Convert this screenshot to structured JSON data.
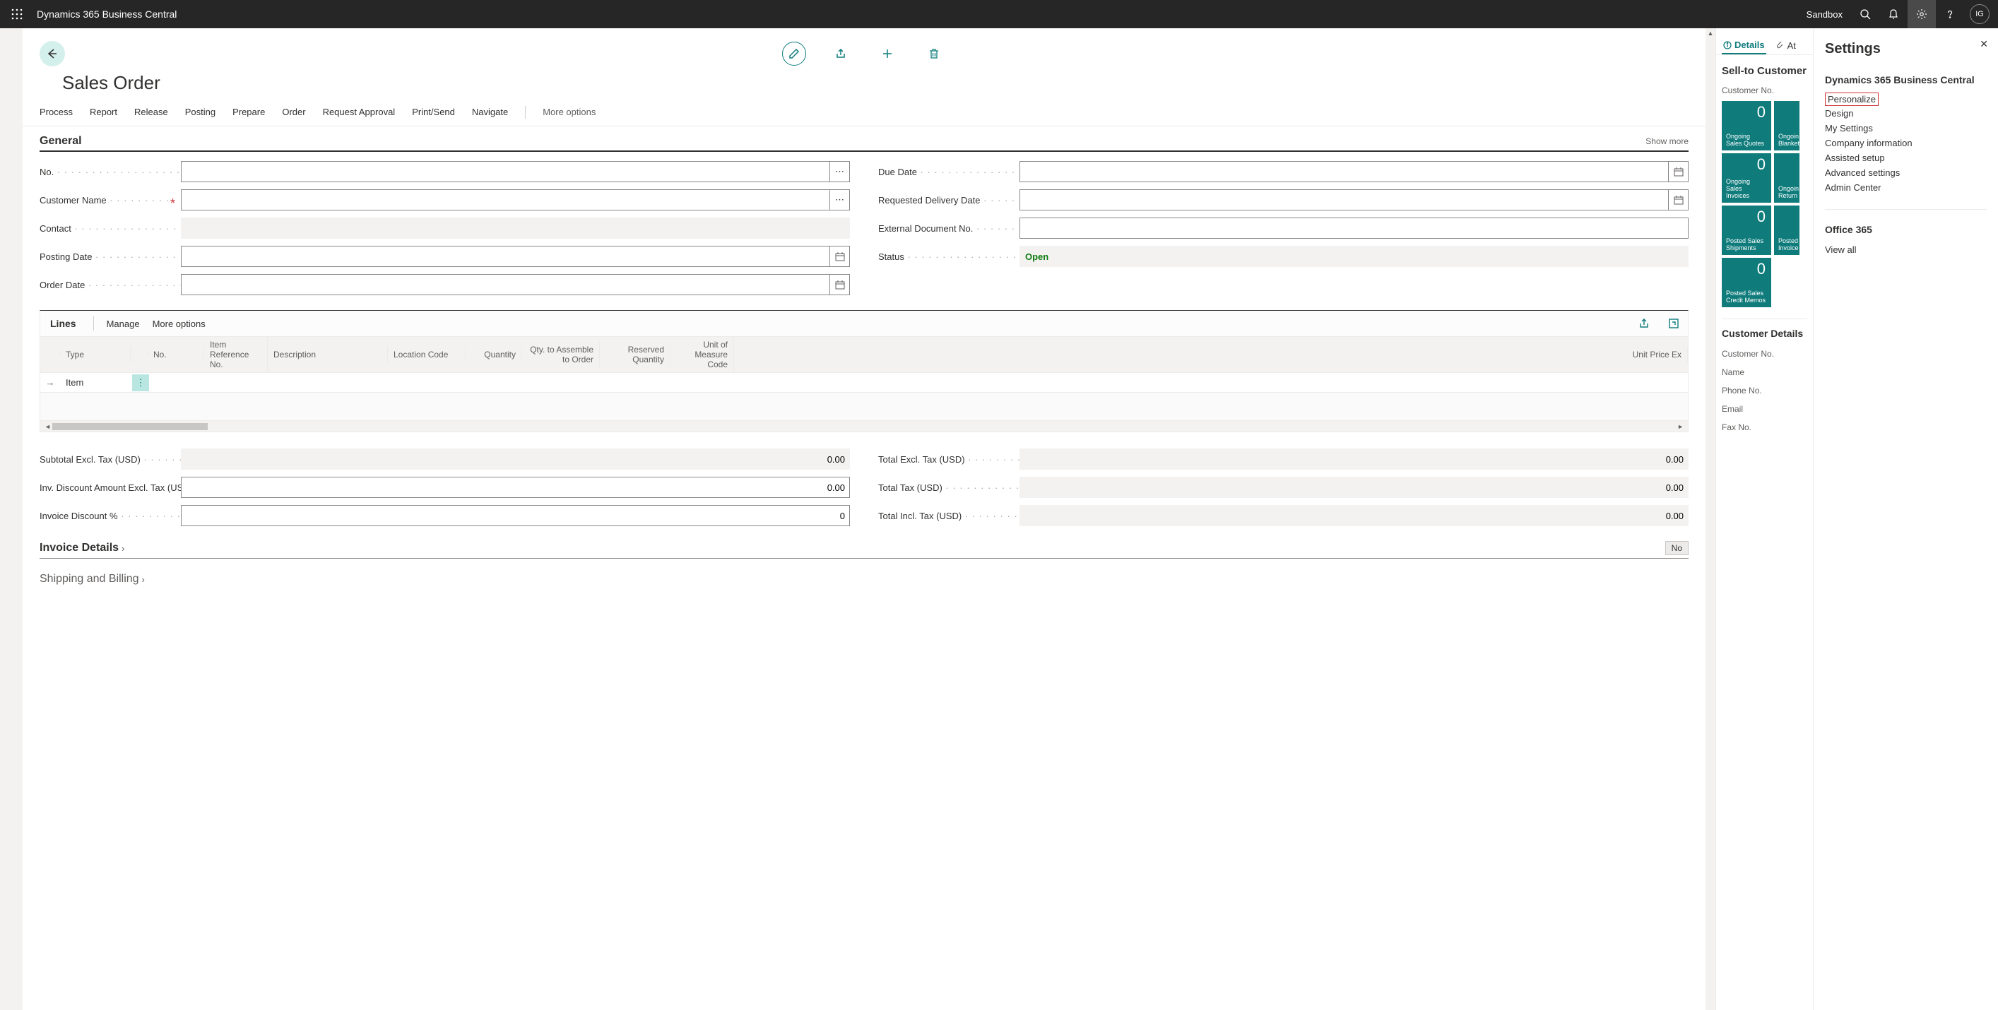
{
  "topbar": {
    "app_title": "Dynamics 365 Business Central",
    "env": "Sandbox",
    "user_initials": "IG"
  },
  "page": {
    "title": "Sales Order"
  },
  "actions": {
    "process": "Process",
    "report": "Report",
    "release": "Release",
    "posting": "Posting",
    "prepare": "Prepare",
    "order": "Order",
    "request_approval": "Request Approval",
    "print_send": "Print/Send",
    "navigate": "Navigate",
    "more": "More options"
  },
  "general": {
    "title": "General",
    "show_more": "Show more",
    "labels": {
      "no": "No.",
      "customer_name": "Customer Name",
      "contact": "Contact",
      "posting_date": "Posting Date",
      "order_date": "Order Date",
      "due_date": "Due Date",
      "requested_delivery": "Requested Delivery Date",
      "external_doc": "External Document No.",
      "status": "Status"
    },
    "values": {
      "no": "",
      "customer_name": "",
      "contact": "",
      "posting_date": "",
      "order_date": "",
      "due_date": "",
      "requested_delivery": "",
      "external_doc": "",
      "status": "Open"
    }
  },
  "lines": {
    "title": "Lines",
    "manage": "Manage",
    "more": "More options",
    "columns": {
      "type": "Type",
      "no": "No.",
      "item_ref": "Item Reference No.",
      "description": "Description",
      "location": "Location Code",
      "quantity": "Quantity",
      "qty_assemble": "Qty. to Assemble to Order",
      "reserved": "Reserved Quantity",
      "uom": "Unit of Measure Code",
      "unit_price": "Unit Price Ex"
    },
    "row0_type": "Item"
  },
  "totals": {
    "subtotal_label": "Subtotal Excl. Tax (USD)",
    "subtotal": "0.00",
    "inv_disc_amt_label": "Inv. Discount Amount Excl. Tax (USD)",
    "inv_disc_amt": "0.00",
    "inv_disc_pct_label": "Invoice Discount %",
    "inv_disc_pct": "0",
    "total_excl_label": "Total Excl. Tax (USD)",
    "total_excl": "0.00",
    "total_tax_label": "Total Tax (USD)",
    "total_tax": "0.00",
    "total_incl_label": "Total Incl. Tax (USD)",
    "total_incl": "0.00"
  },
  "invoice_details": {
    "title": "Invoice Details",
    "badge": "No"
  },
  "shipping": {
    "title": "Shipping and Billing"
  },
  "factbox": {
    "tabs": {
      "details": "Details",
      "attachments": "At"
    },
    "sell_to": "Sell-to Customer",
    "customer_no_label": "Customer No.",
    "tiles": [
      {
        "count": "0",
        "label": "Ongoing Sales Quotes"
      },
      {
        "count": "",
        "label": "Ongoin Blanket"
      },
      {
        "count": "0",
        "label": "Ongoing Sales Invoices"
      },
      {
        "count": "",
        "label": "Ongoin Return"
      },
      {
        "count": "0",
        "label": "Posted Sales Shipments"
      },
      {
        "count": "",
        "label": "Posted Invoice"
      },
      {
        "count": "0",
        "label": "Posted Sales Credit Memos"
      }
    ],
    "cust_details_title": "Customer Details",
    "cust_fields": {
      "customer_no": "Customer No.",
      "name": "Name",
      "phone": "Phone No.",
      "email": "Email",
      "fax": "Fax No."
    }
  },
  "settings": {
    "title": "Settings",
    "group1": "Dynamics 365 Business Central",
    "personalize": "Personalize",
    "design": "Design",
    "my_settings": "My Settings",
    "company_info": "Company information",
    "assisted_setup": "Assisted setup",
    "advanced": "Advanced settings",
    "admin_center": "Admin Center",
    "group2": "Office 365",
    "view_all": "View all"
  }
}
